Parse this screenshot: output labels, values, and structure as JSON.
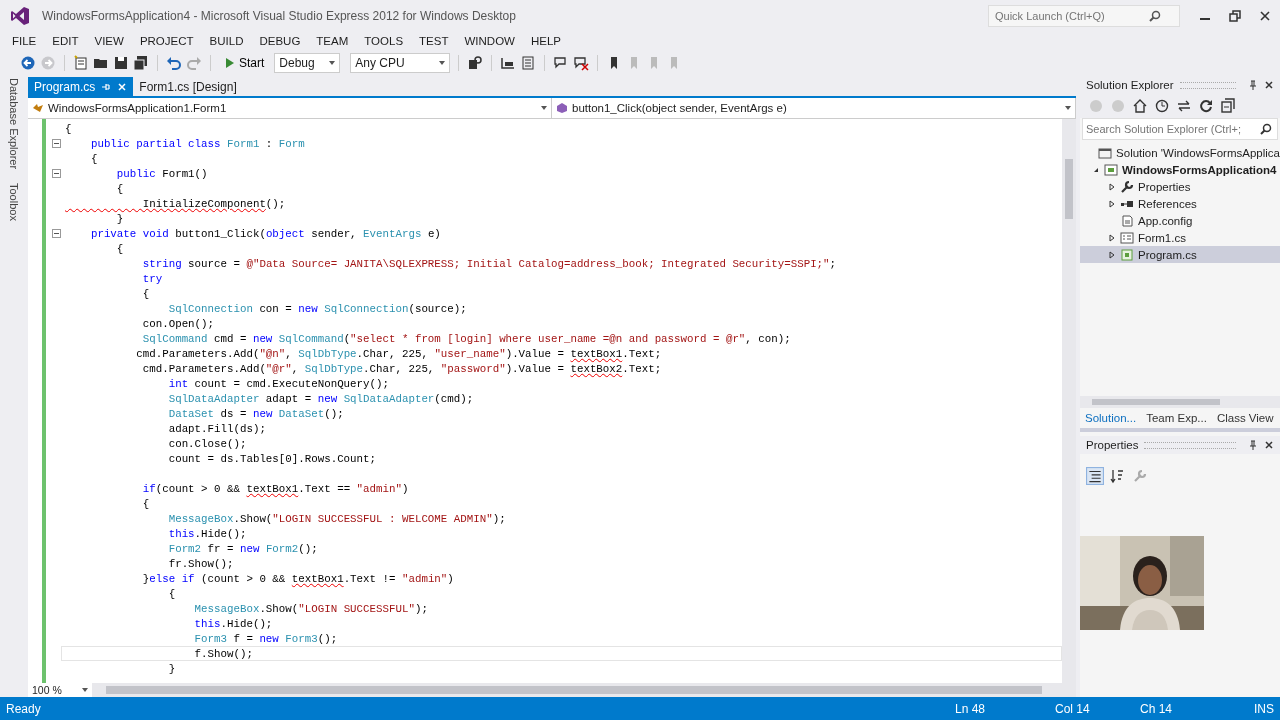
{
  "window": {
    "title": "WindowsFormsApplication4 - Microsoft Visual Studio Express 2012 for Windows Desktop",
    "quick_launch": {
      "placeholder": "Quick Launch (Ctrl+Q)"
    }
  },
  "menu": [
    "FILE",
    "EDIT",
    "VIEW",
    "PROJECT",
    "BUILD",
    "DEBUG",
    "TEAM",
    "TOOLS",
    "TEST",
    "WINDOW",
    "HELP"
  ],
  "toolbar": {
    "start": "Start",
    "configuration": "Debug",
    "platform": "Any CPU"
  },
  "side_tabs": [
    "Database Explorer",
    "Toolbox"
  ],
  "tabs": [
    {
      "label": "Program.cs",
      "selected": true
    },
    {
      "label": "Form1.cs [Design]",
      "selected": false
    }
  ],
  "navigation": {
    "type": "WindowsFormsApplication1.Form1",
    "member": "button1_Click(object sender, EventArgs e)"
  },
  "code": [
    {
      "fold": false,
      "current": false,
      "tokens": [
        {
          "kind": "plain",
          "text": "{"
        }
      ]
    },
    {
      "fold": true,
      "current": false,
      "tokens": [
        {
          "kind": "keyword",
          "text": "    public partial class "
        },
        {
          "kind": "type",
          "text": "Form1"
        },
        {
          "kind": "plain",
          "text": " : "
        },
        {
          "kind": "type",
          "text": "Form"
        }
      ]
    },
    {
      "fold": false,
      "current": false,
      "tokens": [
        {
          "kind": "plain",
          "text": "    {"
        }
      ]
    },
    {
      "fold": true,
      "current": false,
      "tokens": [
        {
          "kind": "keyword",
          "text": "        public "
        },
        {
          "kind": "plain",
          "text": "Form1()"
        }
      ]
    },
    {
      "fold": false,
      "current": false,
      "tokens": [
        {
          "kind": "plain",
          "text": "        {"
        }
      ]
    },
    {
      "fold": false,
      "current": false,
      "tokens": [
        {
          "kind": "error",
          "text": "            InitializeComponent"
        },
        {
          "kind": "plain",
          "text": "();"
        }
      ]
    },
    {
      "fold": false,
      "current": false,
      "tokens": [
        {
          "kind": "plain",
          "text": "        }"
        }
      ]
    },
    {
      "fold": true,
      "current": false,
      "tokens": [
        {
          "kind": "keyword",
          "text": "    private void "
        },
        {
          "kind": "plain",
          "text": "button1_Click("
        },
        {
          "kind": "keyword",
          "text": "object "
        },
        {
          "kind": "plain",
          "text": "sender, "
        },
        {
          "kind": "type",
          "text": "EventArgs"
        },
        {
          "kind": "plain",
          "text": " e)"
        }
      ]
    },
    {
      "fold": false,
      "current": false,
      "tokens": [
        {
          "kind": "plain",
          "text": "        {"
        }
      ]
    },
    {
      "fold": false,
      "current": false,
      "tokens": [
        {
          "kind": "keyword",
          "text": "            string "
        },
        {
          "kind": "plain",
          "text": "source = "
        },
        {
          "kind": "string",
          "text": "@\"Data Source= JANITA\\SQLEXPRESS; Initial Catalog=address_book; Integrated Security=SSPI;\""
        },
        {
          "kind": "plain",
          "text": ";"
        }
      ]
    },
    {
      "fold": false,
      "current": false,
      "tokens": [
        {
          "kind": "keyword",
          "text": "            try"
        }
      ]
    },
    {
      "fold": false,
      "current": false,
      "tokens": [
        {
          "kind": "plain",
          "text": "            {"
        }
      ]
    },
    {
      "fold": false,
      "current": false,
      "tokens": [
        {
          "kind": "type",
          "text": "                SqlConnection"
        },
        {
          "kind": "plain",
          "text": " con = "
        },
        {
          "kind": "keyword",
          "text": "new "
        },
        {
          "kind": "type",
          "text": "SqlConnection"
        },
        {
          "kind": "plain",
          "text": "(source);"
        }
      ]
    },
    {
      "fold": false,
      "current": false,
      "tokens": [
        {
          "kind": "plain",
          "text": "            con.Open();"
        }
      ]
    },
    {
      "fold": false,
      "current": false,
      "tokens": [
        {
          "kind": "type",
          "text": "            SqlCommand"
        },
        {
          "kind": "plain",
          "text": " cmd = "
        },
        {
          "kind": "keyword",
          "text": "new "
        },
        {
          "kind": "type",
          "text": "SqlCommand"
        },
        {
          "kind": "plain",
          "text": "("
        },
        {
          "kind": "string",
          "text": "\"select * from [login] where user_name =@n and password = @r\""
        },
        {
          "kind": "plain",
          "text": ", con);"
        }
      ]
    },
    {
      "fold": false,
      "current": false,
      "tokens": [
        {
          "kind": "plain",
          "text": "           cmd.Parameters.Add("
        },
        {
          "kind": "string",
          "text": "\"@n\""
        },
        {
          "kind": "plain",
          "text": ", "
        },
        {
          "kind": "type",
          "text": "SqlDbType"
        },
        {
          "kind": "plain",
          "text": ".Char, 225, "
        },
        {
          "kind": "string",
          "text": "\"user_name\""
        },
        {
          "kind": "plain",
          "text": ").Value = "
        },
        {
          "kind": "error",
          "text": "textBox1"
        },
        {
          "kind": "plain",
          "text": ".Text;"
        }
      ]
    },
    {
      "fold": false,
      "current": false,
      "tokens": [
        {
          "kind": "plain",
          "text": "            cmd.Parameters.Add("
        },
        {
          "kind": "string",
          "text": "\"@r\""
        },
        {
          "kind": "plain",
          "text": ", "
        },
        {
          "kind": "type",
          "text": "SqlDbType"
        },
        {
          "kind": "plain",
          "text": ".Char, 225, "
        },
        {
          "kind": "string",
          "text": "\"password\""
        },
        {
          "kind": "plain",
          "text": ").Value = "
        },
        {
          "kind": "error",
          "text": "textBox2"
        },
        {
          "kind": "plain",
          "text": ".Text;"
        }
      ]
    },
    {
      "fold": false,
      "current": false,
      "tokens": [
        {
          "kind": "keyword",
          "text": "                int "
        },
        {
          "kind": "plain",
          "text": "count = cmd.ExecuteNonQuery();"
        }
      ]
    },
    {
      "fold": false,
      "current": false,
      "tokens": [
        {
          "kind": "type",
          "text": "                SqlDataAdapter"
        },
        {
          "kind": "plain",
          "text": " adapt = "
        },
        {
          "kind": "keyword",
          "text": "new "
        },
        {
          "kind": "type",
          "text": "SqlDataAdapter"
        },
        {
          "kind": "plain",
          "text": "(cmd);"
        }
      ]
    },
    {
      "fold": false,
      "current": false,
      "tokens": [
        {
          "kind": "type",
          "text": "                DataSet"
        },
        {
          "kind": "plain",
          "text": " ds = "
        },
        {
          "kind": "keyword",
          "text": "new "
        },
        {
          "kind": "type",
          "text": "DataSet"
        },
        {
          "kind": "plain",
          "text": "();"
        }
      ]
    },
    {
      "fold": false,
      "current": false,
      "tokens": [
        {
          "kind": "plain",
          "text": "                adapt.Fill(ds);"
        }
      ]
    },
    {
      "fold": false,
      "current": false,
      "tokens": [
        {
          "kind": "plain",
          "text": "                con.Close();"
        }
      ]
    },
    {
      "fold": false,
      "current": false,
      "tokens": [
        {
          "kind": "plain",
          "text": "                count = ds.Tables[0].Rows.Count;"
        }
      ]
    },
    {
      "fold": false,
      "current": false,
      "space_above": true,
      "tokens": [
        {
          "kind": "keyword",
          "text": "            if"
        },
        {
          "kind": "plain",
          "text": "(count > 0 && "
        },
        {
          "kind": "error",
          "text": "textBox1"
        },
        {
          "kind": "plain",
          "text": ".Text == "
        },
        {
          "kind": "string",
          "text": "\"admin\""
        },
        {
          "kind": "plain",
          "text": ")"
        }
      ]
    },
    {
      "fold": false,
      "current": false,
      "tokens": [
        {
          "kind": "plain",
          "text": "            {"
        }
      ]
    },
    {
      "fold": false,
      "current": false,
      "tokens": [
        {
          "kind": "type",
          "text": "                MessageBox"
        },
        {
          "kind": "plain",
          "text": ".Show("
        },
        {
          "kind": "string",
          "text": "\"LOGIN SUCCESSFUL : WELCOME ADMIN\""
        },
        {
          "kind": "plain",
          "text": ");"
        }
      ]
    },
    {
      "fold": false,
      "current": false,
      "tokens": [
        {
          "kind": "keyword",
          "text": "                this"
        },
        {
          "kind": "plain",
          "text": ".Hide();"
        }
      ]
    },
    {
      "fold": false,
      "current": false,
      "tokens": [
        {
          "kind": "type",
          "text": "                Form2"
        },
        {
          "kind": "plain",
          "text": " fr = "
        },
        {
          "kind": "keyword",
          "text": "new "
        },
        {
          "kind": "type",
          "text": "Form2"
        },
        {
          "kind": "plain",
          "text": "();"
        }
      ]
    },
    {
      "fold": false,
      "current": false,
      "tokens": [
        {
          "kind": "plain",
          "text": "                fr.Show();"
        }
      ]
    },
    {
      "fold": false,
      "current": false,
      "tokens": [
        {
          "kind": "plain",
          "text": "            }"
        },
        {
          "kind": "keyword",
          "text": "else if "
        },
        {
          "kind": "plain",
          "text": "(count > 0 && "
        },
        {
          "kind": "error",
          "text": "textBox1"
        },
        {
          "kind": "plain",
          "text": ".Text != "
        },
        {
          "kind": "string",
          "text": "\"admin\""
        },
        {
          "kind": "plain",
          "text": ")"
        }
      ]
    },
    {
      "fold": false,
      "current": false,
      "tokens": [
        {
          "kind": "plain",
          "text": "                {"
        }
      ]
    },
    {
      "fold": false,
      "current": false,
      "tokens": [
        {
          "kind": "type",
          "text": "                    MessageBox"
        },
        {
          "kind": "plain",
          "text": ".Show("
        },
        {
          "kind": "string",
          "text": "\"LOGIN SUCCESSFUL\""
        },
        {
          "kind": "plain",
          "text": ");"
        }
      ]
    },
    {
      "fold": false,
      "current": false,
      "tokens": [
        {
          "kind": "keyword",
          "text": "                    this"
        },
        {
          "kind": "plain",
          "text": ".Hide();"
        }
      ]
    },
    {
      "fold": false,
      "current": false,
      "tokens": [
        {
          "kind": "type",
          "text": "                    Form3"
        },
        {
          "kind": "plain",
          "text": " f = "
        },
        {
          "kind": "keyword",
          "text": "new "
        },
        {
          "kind": "type",
          "text": "Form3"
        },
        {
          "kind": "plain",
          "text": "();"
        }
      ]
    },
    {
      "fold": false,
      "current": true,
      "tokens": [
        {
          "kind": "plain",
          "text": "                    f.Show();"
        }
      ]
    },
    {
      "fold": false,
      "current": false,
      "tokens": [
        {
          "kind": "plain",
          "text": "                }"
        }
      ]
    }
  ],
  "zoom": "100 %",
  "solution_explorer": {
    "title": "Solution Explorer",
    "search": {
      "placeholder": "Search Solution Explorer (Ctrl+;"
    },
    "tree": [
      {
        "label": "Solution 'WindowsFormsApplica",
        "kind": "solution",
        "bold": false,
        "selected": false
      },
      {
        "label": "WindowsFormsApplication4",
        "kind": "project",
        "expanded": true,
        "bold": true,
        "selected": false,
        "children": [
          {
            "label": "Properties",
            "kind": "properties",
            "expanded": false,
            "bold": false,
            "selected": false
          },
          {
            "label": "References",
            "kind": "references",
            "expanded": false,
            "bold": false,
            "selected": false
          },
          {
            "label": "App.config",
            "kind": "config",
            "bold": false,
            "selected": false
          },
          {
            "label": "Form1.cs",
            "kind": "form",
            "expanded": false,
            "bold": false,
            "selected": false
          },
          {
            "label": "Program.cs",
            "kind": "code",
            "expanded": false,
            "bold": false,
            "selected": true
          }
        ]
      }
    ],
    "tabs": [
      {
        "label": "Solution...",
        "selected": true
      },
      {
        "label": "Team Exp...",
        "selected": false
      },
      {
        "label": "Class View",
        "selected": false
      }
    ]
  },
  "properties": {
    "title": "Properties"
  },
  "status_bar": {
    "message": "Ready",
    "line": "Ln 48",
    "column": "Col 14",
    "char": "Ch 14",
    "mode": "INS"
  }
}
